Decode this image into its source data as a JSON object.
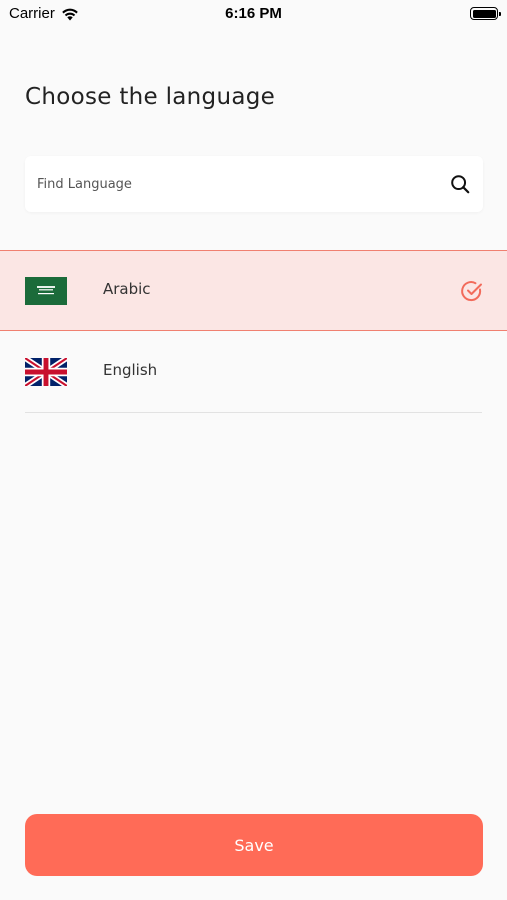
{
  "status_bar": {
    "carrier": "Carrier",
    "time": "6:16 PM"
  },
  "header": {
    "title": "Choose the language"
  },
  "search": {
    "placeholder": "Find Language",
    "value": ""
  },
  "languages": [
    {
      "label": "Arabic",
      "flag": "saudi-arabia-flag",
      "selected": true
    },
    {
      "label": "English",
      "flag": "united-kingdom-flag",
      "selected": false
    }
  ],
  "actions": {
    "save_label": "Save"
  },
  "colors": {
    "accent": "#ff6b57",
    "selected_bg": "#fbe6e4",
    "selected_border": "#f08070",
    "background": "#fafafa"
  }
}
